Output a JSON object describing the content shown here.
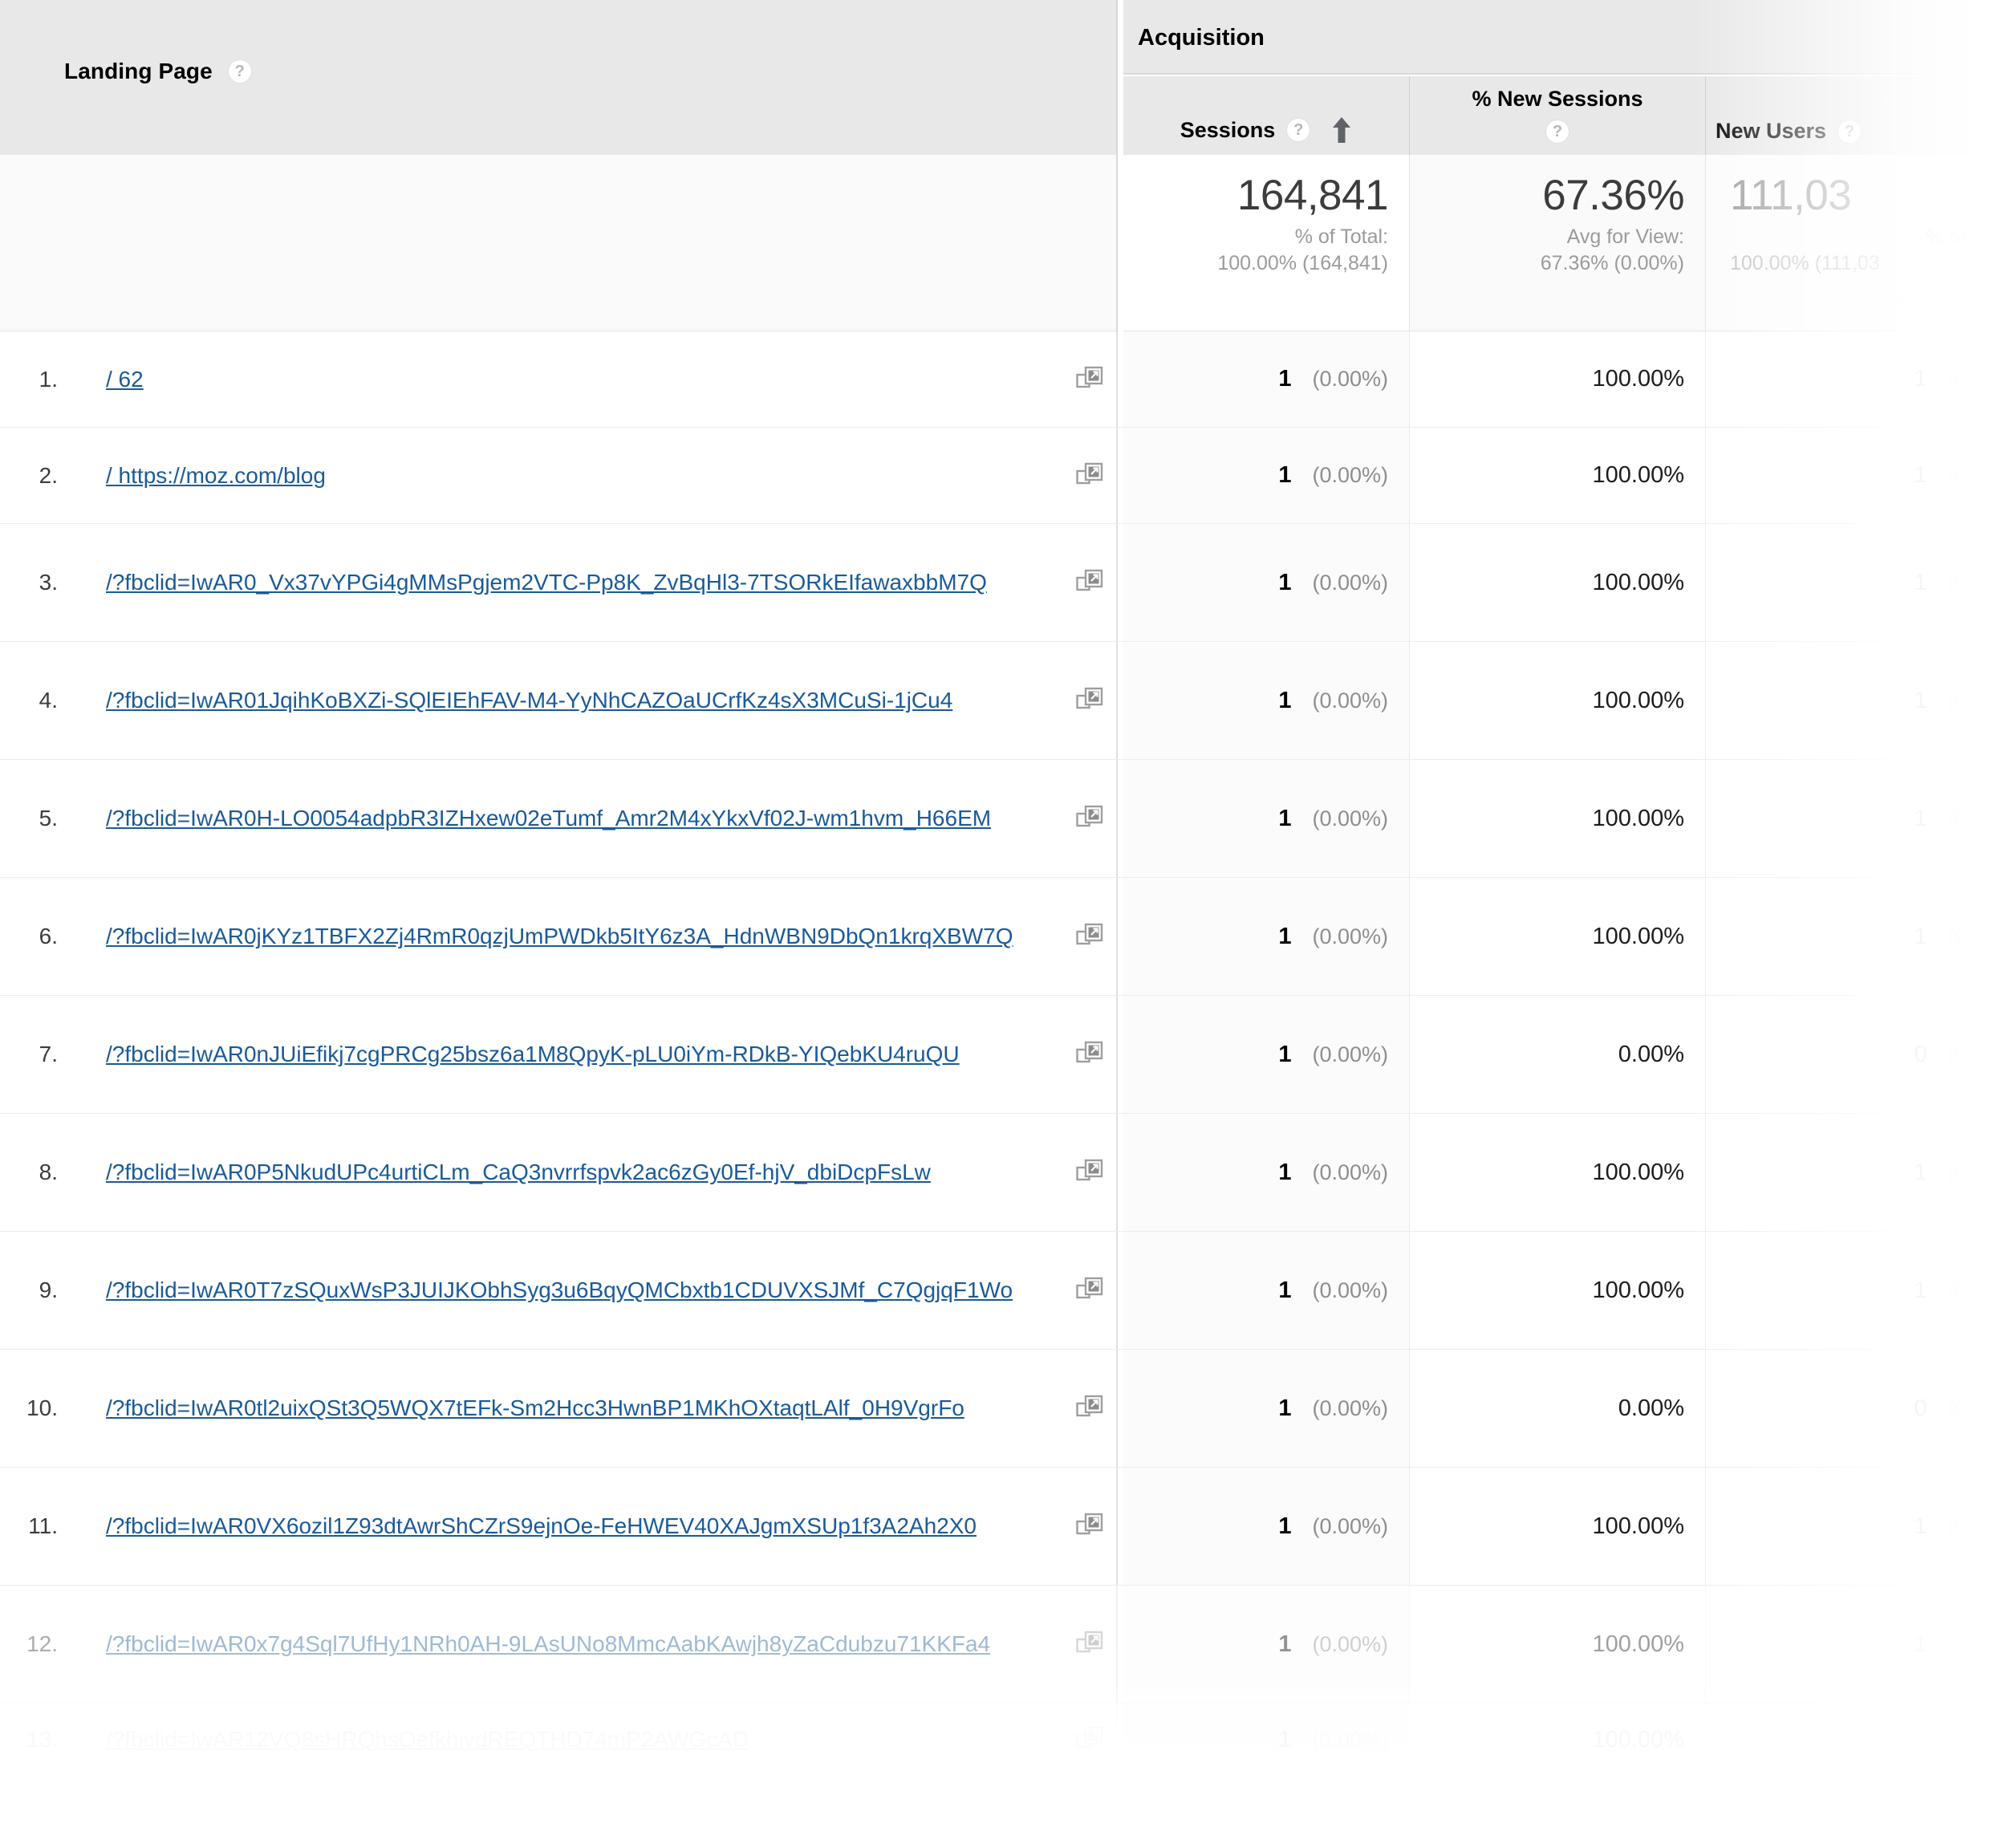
{
  "dimension_header": {
    "label": "Landing Page",
    "help_icon": "help-question-icon",
    "help_glyph": "?"
  },
  "group_header": {
    "label": "Acquisition"
  },
  "metrics": [
    {
      "key": "sessions",
      "label": "Sessions",
      "help_glyph": "?",
      "sorted": true,
      "sort_direction": "asc",
      "sort_glyph": "↑"
    },
    {
      "key": "newsess",
      "label": "% New Sessions",
      "help_glyph": "?",
      "sorted": false,
      "stacked": true
    },
    {
      "key": "newusers",
      "label": "New Users",
      "help_glyph": "?",
      "sorted": false
    }
  ],
  "summary": {
    "sessions": {
      "value": "164,841",
      "sub_label": "% of Total:",
      "sub_value": "100.00% (164,841)"
    },
    "newsess": {
      "value": "67.36%",
      "sub_label": "Avg for View:",
      "sub_value": "67.36% (0.00%)"
    },
    "newusers": {
      "value": "111,03",
      "sub_label": "% of Tot",
      "sub_value": "100.00% (111,03"
    }
  },
  "rows": [
    {
      "rank": "1.",
      "page": "/ 62",
      "sessions": "1",
      "sessions_pct": "(0.00%)",
      "new_sessions": "100.00%",
      "new_users": "1",
      "new_users_pct": "(0.0"
    },
    {
      "rank": "2.",
      "page": "/ https://moz.com/blog",
      "sessions": "1",
      "sessions_pct": "(0.00%)",
      "new_sessions": "100.00%",
      "new_users": "1",
      "new_users_pct": "(0.0"
    },
    {
      "rank": "3.",
      "page": "/?fbclid=IwAR0_Vx37vYPGi4gMMsPgjem2VTC-Pp8K_ZvBqHl3-7TSORkEIfawaxbbM7Q",
      "sessions": "1",
      "sessions_pct": "(0.00%)",
      "new_sessions": "100.00%",
      "new_users": "1",
      "new_users_pct": "(0.0"
    },
    {
      "rank": "4.",
      "page": "/?fbclid=IwAR01JqihKoBXZi-SQlEIEhFAV-M4-YyNhCAZOaUCrfKz4sX3MCuSi-1jCu4",
      "sessions": "1",
      "sessions_pct": "(0.00%)",
      "new_sessions": "100.00%",
      "new_users": "1",
      "new_users_pct": "(0.0"
    },
    {
      "rank": "5.",
      "page": "/?fbclid=IwAR0H-LO0054adpbR3IZHxew02eTumf_Amr2M4xYkxVf02J-wm1hvm_H66EM",
      "sessions": "1",
      "sessions_pct": "(0.00%)",
      "new_sessions": "100.00%",
      "new_users": "1",
      "new_users_pct": "(0.0"
    },
    {
      "rank": "6.",
      "page": "/?fbclid=IwAR0jKYz1TBFX2Zj4RmR0qzjUmPWDkb5ItY6z3A_HdnWBN9DbQn1krqXBW7Q",
      "sessions": "1",
      "sessions_pct": "(0.00%)",
      "new_sessions": "100.00%",
      "new_users": "1",
      "new_users_pct": "(0.0"
    },
    {
      "rank": "7.",
      "page": "/?fbclid=IwAR0nJUiEfikj7cgPRCg25bsz6a1M8QpyK-pLU0iYm-RDkB-YIQebKU4ruQU",
      "sessions": "1",
      "sessions_pct": "(0.00%)",
      "new_sessions": "0.00%",
      "new_users": "0",
      "new_users_pct": "(0.0"
    },
    {
      "rank": "8.",
      "page": "/?fbclid=IwAR0P5NkudUPc4urtiCLm_CaQ3nvrrfspvk2ac6zGy0Ef-hjV_dbiDcpFsLw",
      "sessions": "1",
      "sessions_pct": "(0.00%)",
      "new_sessions": "100.00%",
      "new_users": "1",
      "new_users_pct": "(0.0"
    },
    {
      "rank": "9.",
      "page": "/?fbclid=IwAR0T7zSQuxWsP3JUIJKObhSyg3u6BqyQMCbxtb1CDUVXSJMf_C7QgjqF1Wo",
      "sessions": "1",
      "sessions_pct": "(0.00%)",
      "new_sessions": "100.00%",
      "new_users": "1",
      "new_users_pct": "(0.0"
    },
    {
      "rank": "10.",
      "page": "/?fbclid=IwAR0tl2uixQSt3Q5WQX7tEFk-Sm2Hcc3HwnBP1MKhOXtaqtLAlf_0H9VgrFo",
      "sessions": "1",
      "sessions_pct": "(0.00%)",
      "new_sessions": "0.00%",
      "new_users": "0",
      "new_users_pct": "(0.0"
    },
    {
      "rank": "11.",
      "page": "/?fbclid=IwAR0VX6ozil1Z93dtAwrShCZrS9ejnOe-FeHWEV40XAJgmXSUp1f3A2Ah2X0",
      "sessions": "1",
      "sessions_pct": "(0.00%)",
      "new_sessions": "100.00%",
      "new_users": "1",
      "new_users_pct": "(0.0"
    },
    {
      "rank": "12.",
      "page": "/?fbclid=IwAR0x7g4Sql7UfHy1NRh0AH-9LAsUNo8MmcAabKAwjh8yZaCdubzu71KKFa4",
      "sessions": "1",
      "sessions_pct": "(0.00%)",
      "new_sessions": "100.00%",
      "new_users": "1",
      "new_users_pct": "(0.0"
    },
    {
      "rank": "13.",
      "page": "/?fbclid=IwAR12VQ8sHRQhsOefkhivdREQTHD74mP2AWGcAD",
      "sessions": "1",
      "sessions_pct": "(0.00%)",
      "new_sessions": "100.00%",
      "new_users": "1",
      "new_users_pct": "(0.0"
    }
  ],
  "icons": {
    "external_link": "external-link-icon",
    "sort_up": "sort-ascending-arrow-icon"
  },
  "colors": {
    "link": "#1a5a99",
    "header_bg": "#e8e8e8",
    "row_border": "#ededed",
    "muted_text": "#8e8e8e"
  }
}
